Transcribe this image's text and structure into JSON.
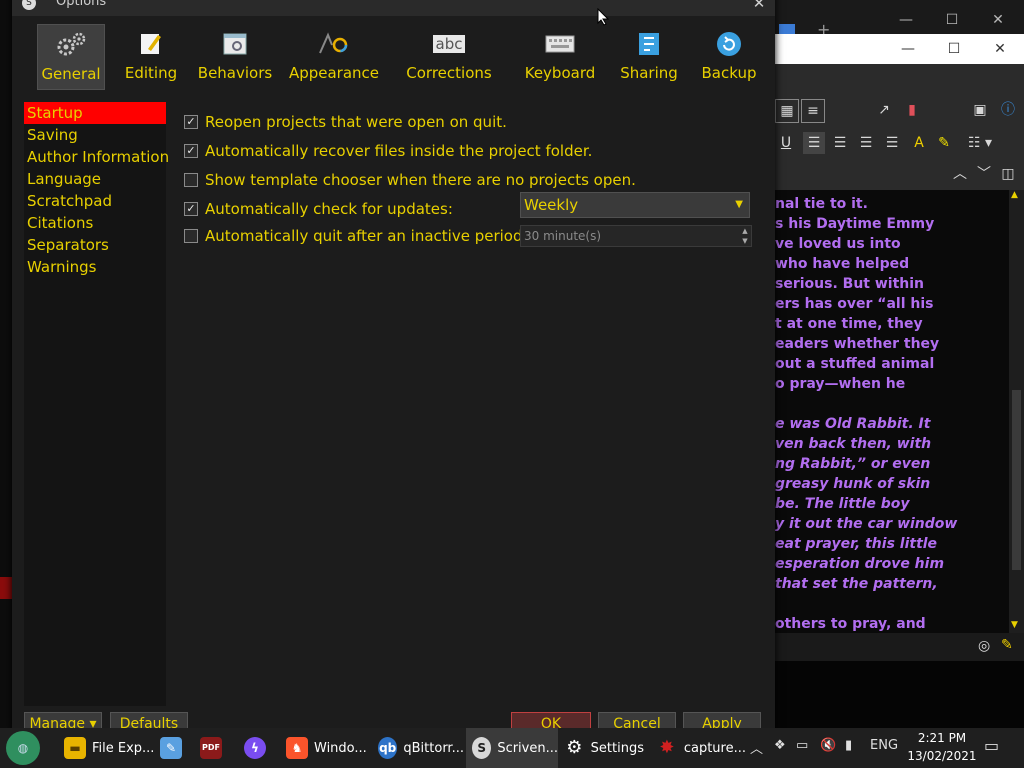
{
  "dialog": {
    "title": "Options",
    "close_label": "✕",
    "tabs": [
      {
        "label": "General",
        "icon": "gears-icon",
        "active": true
      },
      {
        "label": "Editing",
        "icon": "pencil-icon"
      },
      {
        "label": "Behaviors",
        "icon": "behaviors-icon"
      },
      {
        "label": "Appearance",
        "icon": "shapes-icon"
      },
      {
        "label": "Corrections",
        "icon": "abc-icon"
      },
      {
        "label": "Keyboard",
        "icon": "keyboard-icon"
      },
      {
        "label": "Sharing",
        "icon": "sharing-icon"
      },
      {
        "label": "Backup",
        "icon": "backup-icon"
      }
    ],
    "sidebar": [
      {
        "label": "Startup",
        "selected": true
      },
      {
        "label": "Saving"
      },
      {
        "label": "Author Information"
      },
      {
        "label": "Language"
      },
      {
        "label": "Scratchpad"
      },
      {
        "label": "Citations"
      },
      {
        "label": "Separators"
      },
      {
        "label": "Warnings"
      }
    ],
    "options": [
      {
        "label": "Reopen projects that were open on quit.",
        "checked": true
      },
      {
        "label": "Automatically recover files inside the project folder.",
        "checked": true
      },
      {
        "label": "Show template chooser when there are no projects open.",
        "checked": false
      },
      {
        "label": "Automatically check for updates:",
        "checked": true
      },
      {
        "label": "Automatically quit after an inactive period of:",
        "checked": false
      }
    ],
    "update_frequency": "Weekly",
    "inactive_period": "30 minute(s)",
    "footer": {
      "manage": "Manage",
      "defaults": "Defaults",
      "ok": "OK",
      "cancel": "Cancel",
      "apply": "Apply"
    },
    "colors": {
      "accent_text": "#e8d000",
      "selection": "#ff0000"
    }
  },
  "background_doc": {
    "lines": [
      {
        "text": "nal tie to it.",
        "italic": false
      },
      {
        "text": "s his Daytime Emmy",
        "italic": false
      },
      {
        "text": "ve loved us into",
        "italic": false
      },
      {
        "text": "who have helped",
        "italic": false
      },
      {
        "text": "serious. But within",
        "italic": false
      },
      {
        "text": "ers has over “all his",
        "italic": false
      },
      {
        "text": "t at one time, they",
        "italic": false
      },
      {
        "text": "eaders whether they",
        "italic": false
      },
      {
        "text": "out a stuffed animal",
        "italic": false
      },
      {
        "text": "o pray—when he",
        "italic": false
      },
      {
        "text": "",
        "italic": false
      },
      {
        "text": "e was Old Rabbit. It",
        "italic": true
      },
      {
        "text": "ven back then, with",
        "italic": true
      },
      {
        "text": "ng Rabbit,” or even",
        "italic": true
      },
      {
        "text": "greasy hunk of skin",
        "italic": true
      },
      {
        "text": "be. The little boy",
        "italic": true
      },
      {
        "text": "y it out the car window",
        "italic": true
      },
      {
        "text": "eat prayer, this little",
        "italic": true
      },
      {
        "text": "esperation drove him",
        "italic": true
      },
      {
        "text": "that set the pattern,",
        "italic": true
      },
      {
        "text": "",
        "italic": false
      },
      {
        "text": "others to pray, and",
        "italic": false
      }
    ],
    "text_color": "#b26ef0"
  },
  "taskbar": {
    "apps": [
      {
        "label": "File Exp...",
        "icon": "folder-icon"
      },
      {
        "label": "",
        "icon": "notepad-icon"
      },
      {
        "label": "",
        "icon": "pdf-icon"
      },
      {
        "label": "",
        "icon": "messenger-icon"
      },
      {
        "label": "Windo...",
        "icon": "brave-icon"
      },
      {
        "label": "qBittorr...",
        "icon": "qbittorrent-icon"
      },
      {
        "label": "Scriven...",
        "icon": "scrivener-icon"
      },
      {
        "label": "Settings",
        "icon": "settings-gear-icon"
      },
      {
        "label": "capture...",
        "icon": "capture-icon"
      }
    ],
    "language": "ENG",
    "time": "2:21 PM",
    "date": "13/02/2021"
  }
}
